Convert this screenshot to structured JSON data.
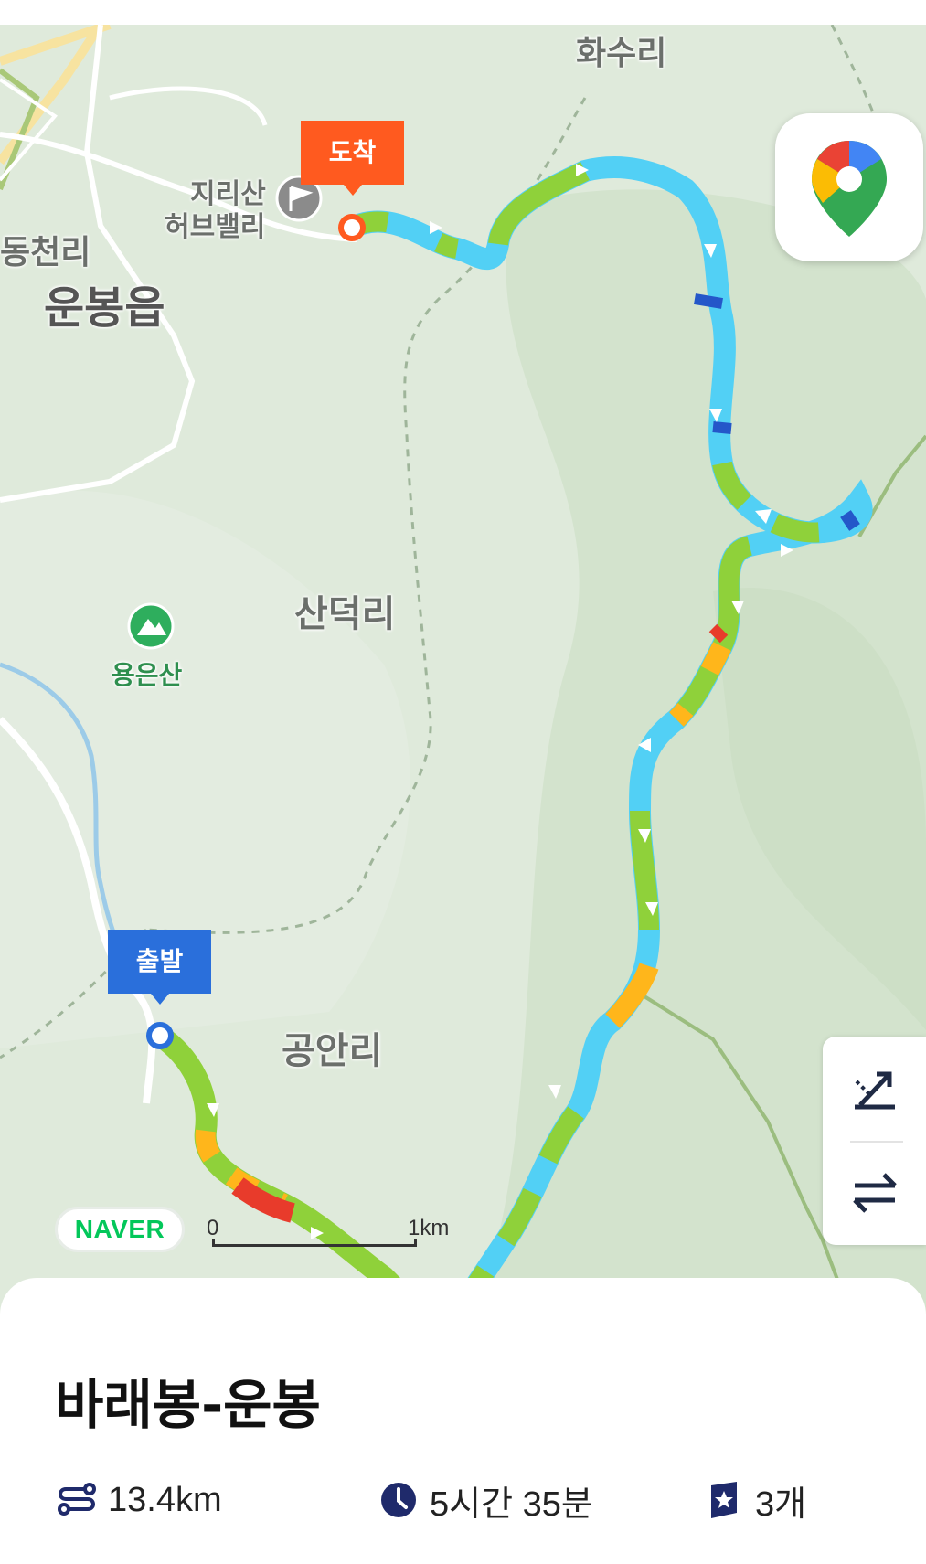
{
  "map": {
    "labels": {
      "hwasuri": "화수리",
      "jirisan": "지리산",
      "herb_valley": "허브밸리",
      "dongcheonri": "동천리",
      "unbongeup": "운봉읍",
      "sandeokri": "산덕리",
      "yongeunsan": "용은산",
      "gonganri": "공안리"
    },
    "arrival_label": "도착",
    "departure_label": "출발",
    "brand": "NAVER",
    "scale": {
      "start": "0",
      "end": "1km"
    },
    "route_colors": [
      "#8fd13a",
      "#52d0f5",
      "#ffb61b",
      "#e83b2b",
      "#2457c9"
    ]
  },
  "buttons": {
    "google_maps": "google-maps-app-icon",
    "measure": "slope-measure-icon",
    "swap": "swap-direction-icon"
  },
  "course": {
    "title": "바래봉-운봉",
    "distance": "13.4km",
    "duration": "5시간 35분",
    "stamps": "3개"
  }
}
